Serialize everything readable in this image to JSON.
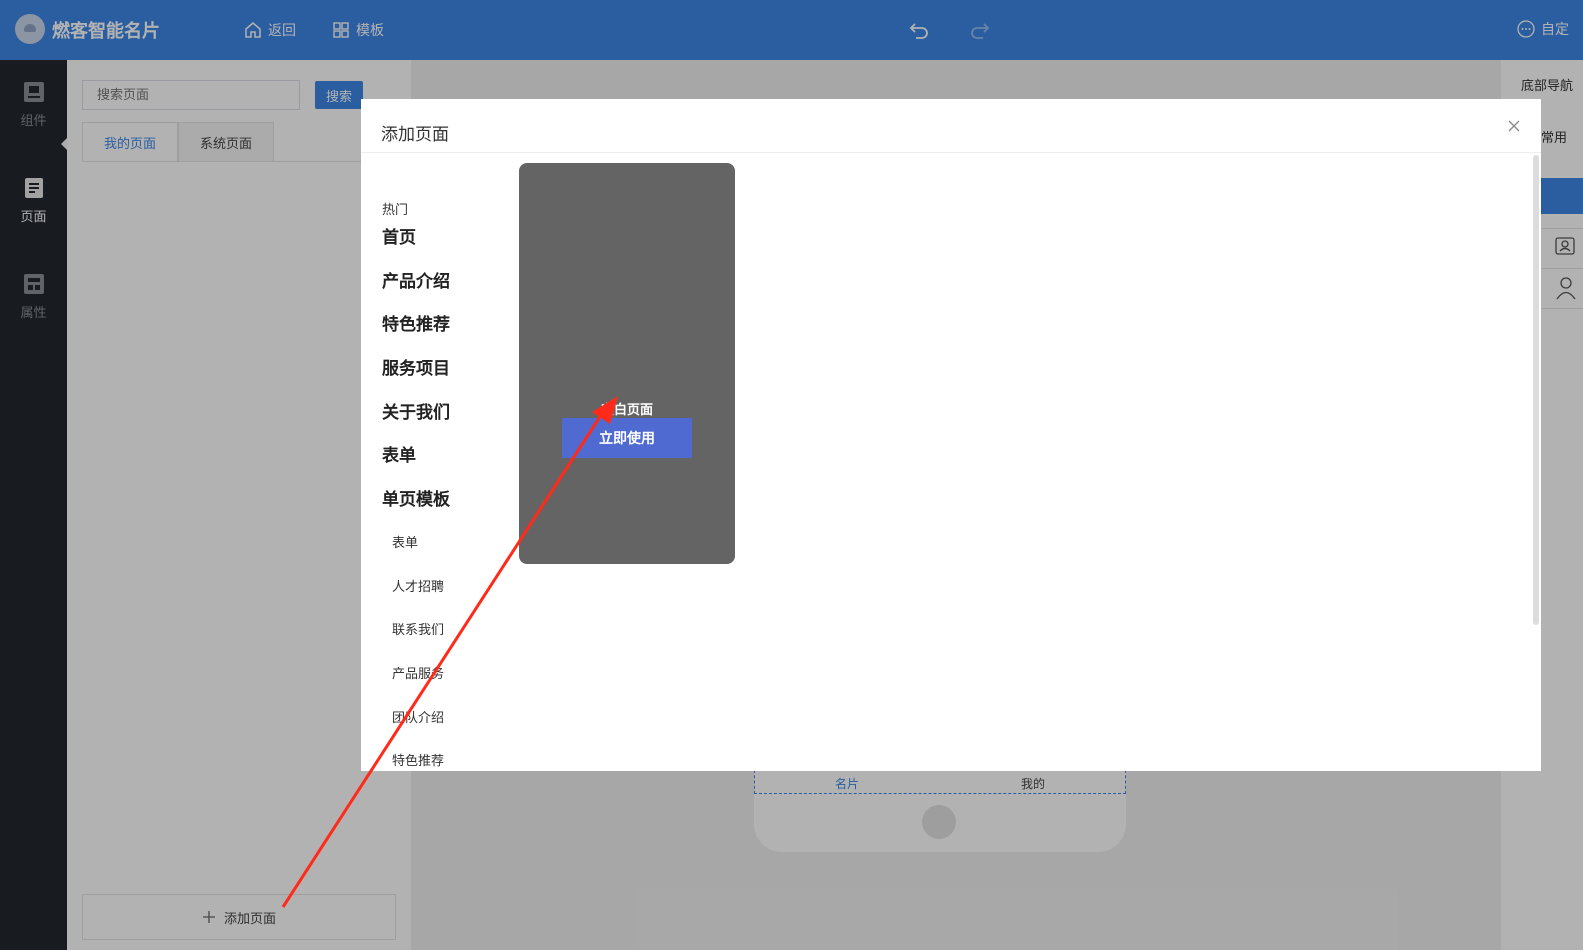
{
  "header": {
    "app_title": "燃客智能名片",
    "back_label": "返回",
    "template_label": "模板",
    "custom_label": "自定"
  },
  "rail": {
    "items": [
      {
        "label": "组件",
        "icon": "component-icon"
      },
      {
        "label": "页面",
        "icon": "page-icon"
      },
      {
        "label": "属性",
        "icon": "property-icon"
      }
    ]
  },
  "page_panel": {
    "search_placeholder": "搜索页面",
    "search_button": "搜索",
    "tabs": [
      "我的页面",
      "系统页面"
    ],
    "add_page_label": "添加页面"
  },
  "phone": {
    "tabbar": [
      "名片",
      "我的"
    ]
  },
  "right_panel": {
    "title": "底部导航",
    "common_label": "常用"
  },
  "modal": {
    "title": "添加页面",
    "hot_label": "热门",
    "categories": [
      "首页",
      "产品介绍",
      "特色推荐",
      "服务项目",
      "关于我们",
      "表单",
      "单页模板"
    ],
    "sub_categories": [
      "表单",
      "人才招聘",
      "联系我们",
      "产品服务",
      "团队介绍",
      "特色推荐"
    ],
    "template": {
      "name": "空白页面",
      "use_button": "立即使用"
    }
  },
  "colors": {
    "header": "#3d87e6",
    "rail": "#23272e",
    "use_button": "#4f6bd1",
    "template_card": "#646464",
    "annotation_arrow": "#ff2a1a"
  }
}
